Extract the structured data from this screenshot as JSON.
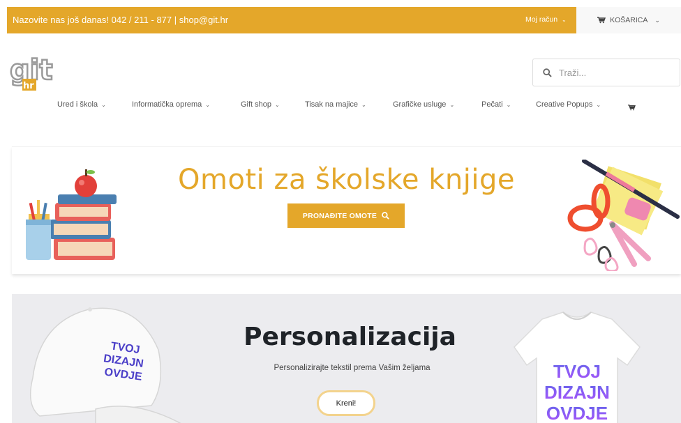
{
  "topbar": {
    "contact_text": "Nazovite nas još danas! 042 / 211 - 877  | shop@git.hr",
    "account_label": "Moj račun",
    "cart_label": "KOŠARICA",
    "bg_color": "#e4a72a"
  },
  "logo": {
    "text_main": "git",
    "text_sub": "hr"
  },
  "search": {
    "placeholder": "Traži..."
  },
  "nav": {
    "items": [
      {
        "label": "Ured i škola"
      },
      {
        "label": "Informatička oprema"
      },
      {
        "label": "Gift shop"
      },
      {
        "label": "Tisak na majice"
      },
      {
        "label": "Grafičke usluge"
      },
      {
        "label": "Pečati"
      },
      {
        "label": "Creative Popups"
      }
    ]
  },
  "hero1": {
    "title": "Omoti za školske knjige",
    "button_label": "PRONAĐITE OMOTE"
  },
  "hero2": {
    "title": "Personalizacija",
    "subtitle": "Personalizirajte tekstil prema Vašim željama",
    "button_label": "Kreni!",
    "cap_print": [
      "TVOJ",
      "DIZAJN",
      "OVDJE"
    ],
    "shirt_print": [
      "TVOJ",
      "DIZAJN",
      "OVDJE"
    ]
  },
  "colors": {
    "accent": "#e4a72a",
    "accent_light": "#f3d38d",
    "dark": "#1f2328"
  }
}
